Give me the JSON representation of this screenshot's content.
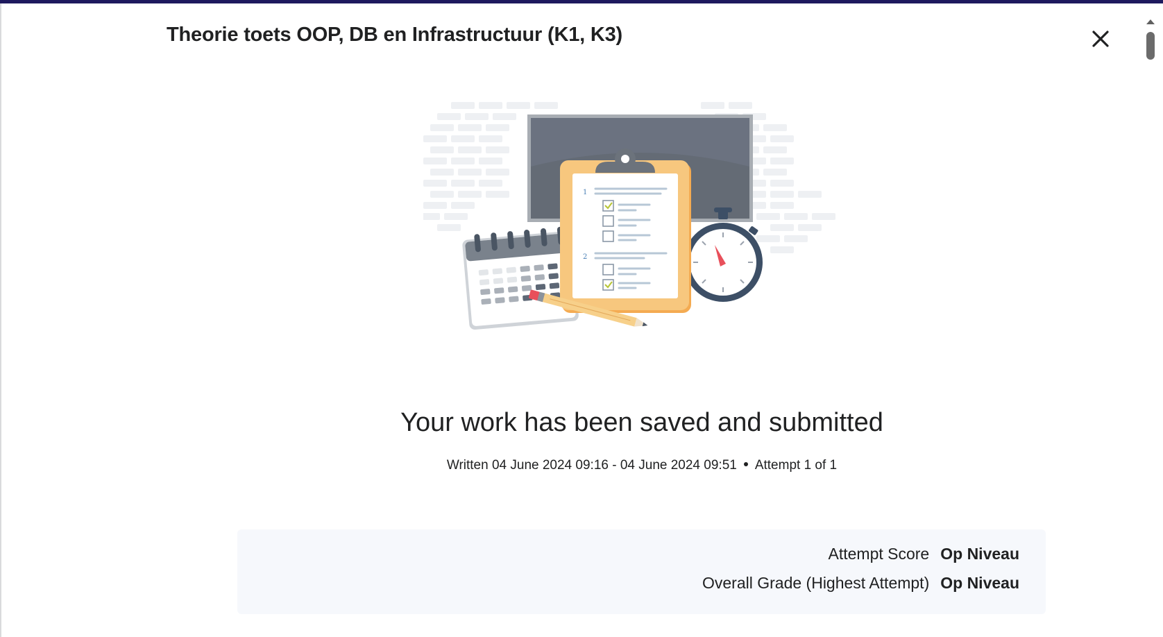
{
  "dialog": {
    "title": "Theorie toets OOP, DB en Infrastructuur (K1, K3)",
    "close_icon": "close-icon"
  },
  "illustration": {
    "checklist_numbers": [
      "1",
      "2"
    ],
    "icons": [
      "calendar-icon",
      "clipboard-icon",
      "stopwatch-icon",
      "pencil-icon",
      "chalkboard-icon"
    ]
  },
  "confirmation": {
    "headline": "Your work has been saved and submitted",
    "written": "Written 04 June 2024 09:16 - 04 June 2024 09:51",
    "attempt": "Attempt 1 of 1"
  },
  "scores": {
    "attempt_score_label": "Attempt Score",
    "attempt_score_value": "Op Niveau",
    "overall_grade_label": "Overall Grade (Highest Attempt)",
    "overall_grade_value": "Op Niveau"
  },
  "colors": {
    "topbar": "#1e1a5e",
    "clipboard": "#f7c77e",
    "board": "#6b7280",
    "stopwatch": "#3d4f66",
    "needle": "#e8505b"
  }
}
